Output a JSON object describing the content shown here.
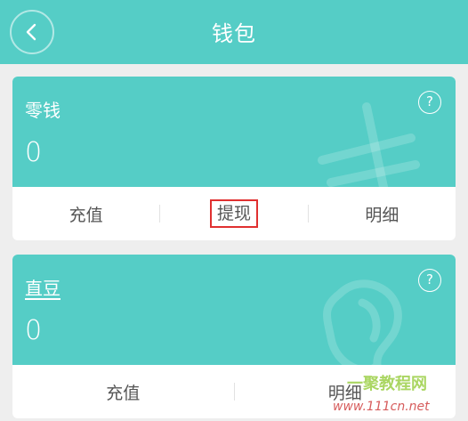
{
  "header": {
    "title": "钱包"
  },
  "cards": [
    {
      "name": "零钱",
      "amount": "0",
      "help": "?",
      "actions": [
        "充值",
        "提现",
        "明细"
      ]
    },
    {
      "name": "直豆",
      "amount": "0",
      "help": "?",
      "actions": [
        "充值",
        "明细"
      ]
    }
  ],
  "colors": {
    "accent": "#55cdc6",
    "highlight": "#e03030"
  },
  "watermark_text": [
    "一聚教程网",
    "www.111cn.net"
  ]
}
